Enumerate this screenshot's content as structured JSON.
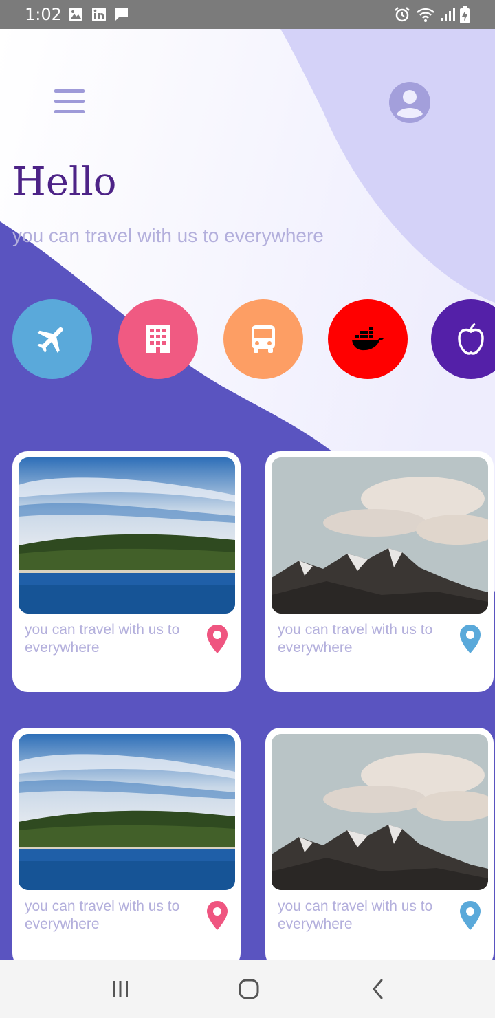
{
  "status_bar": {
    "time": "1:02",
    "left_icons": [
      "image-icon",
      "linkedin-icon",
      "chat-icon"
    ],
    "right_icons": [
      "alarm-icon",
      "wifi-icon",
      "signal-icon",
      "battery-charging-icon"
    ]
  },
  "header": {
    "menu_icon": "hamburger-menu-icon",
    "profile_icon": "account-circle-icon",
    "greeting": "Hello",
    "subtitle": "you can travel with us to everywhere"
  },
  "categories": [
    {
      "icon": "airplane-icon",
      "color": "#5aa9da"
    },
    {
      "icon": "building-icon",
      "color": "#f05a82"
    },
    {
      "icon": "bus-icon",
      "color": "#fd9e64"
    },
    {
      "icon": "docker-whale-icon",
      "color": "#ff0000"
    },
    {
      "icon": "apple-icon",
      "color": "#5420a8"
    }
  ],
  "cards": [
    {
      "image": "lake-landscape",
      "text": "you can travel with us to everywhere",
      "pin_color": "#ef5580"
    },
    {
      "image": "mountain-landscape",
      "text": "you can travel with us to everywhere",
      "pin_color": "#5aa9da"
    },
    {
      "image": "lake-landscape",
      "text": "you can travel with us to everywhere",
      "pin_color": "#ef5580"
    },
    {
      "image": "mountain-landscape",
      "text": "you can travel with us to everywhere",
      "pin_color": "#5aa9da"
    }
  ],
  "nav_bar": {
    "buttons": [
      "recent-apps-icon",
      "home-icon",
      "back-icon"
    ]
  },
  "colors": {
    "accent_purple": "#5a54c0",
    "title_purple": "#4d2387",
    "subtitle": "#b3afdc",
    "lavender": "#d4d2f8"
  }
}
